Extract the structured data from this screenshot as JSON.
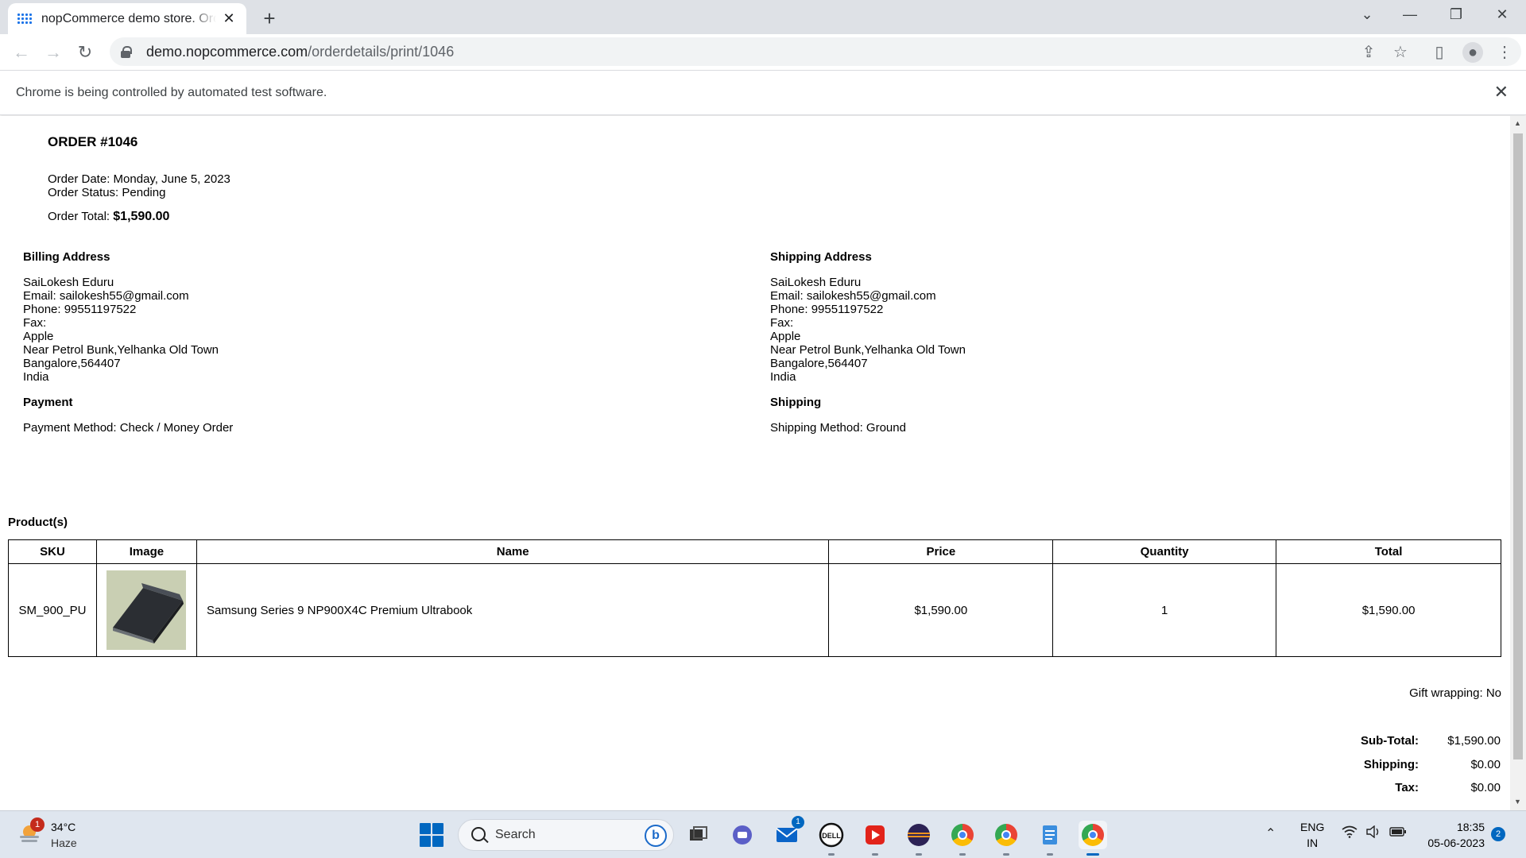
{
  "browser": {
    "tab_title": "nopCommerce demo store. Order details",
    "url_host": "demo.nopcommerce.com",
    "url_path": "/orderdetails/print/1046",
    "infobar_text": "Chrome is being controlled by automated test software."
  },
  "order": {
    "title": "ORDER #1046",
    "date_label": "Order Date:",
    "date_value": "Monday, June 5, 2023",
    "status_label": "Order Status:",
    "status_value": "Pending",
    "total_label": "Order Total:",
    "total_value": "$1,590.00"
  },
  "billing": {
    "title": "Billing Address",
    "lines": [
      "SaiLokesh Eduru",
      "Email: sailokesh55@gmail.com",
      "Phone: 99551197522",
      "Fax:",
      "Apple",
      "Near Petrol Bunk,Yelhanka Old Town",
      "Bangalore,564407",
      "India"
    ]
  },
  "shipping_address": {
    "title": "Shipping Address",
    "lines": [
      "SaiLokesh Eduru",
      "Email: sailokesh55@gmail.com",
      "Phone: 99551197522",
      "Fax:",
      "Apple",
      "Near Petrol Bunk,Yelhanka Old Town",
      "Bangalore,564407",
      "India"
    ]
  },
  "payment": {
    "title": "Payment",
    "method": "Payment Method: Check / Money Order"
  },
  "shipping": {
    "title": "Shipping",
    "method": "Shipping Method: Ground"
  },
  "products": {
    "title": "Product(s)",
    "headers": [
      "SKU",
      "Image",
      "Name",
      "Price",
      "Quantity",
      "Total"
    ],
    "rows": [
      {
        "sku": "SM_900_PU",
        "name": "Samsung Series 9 NP900X4C Premium Ultrabook",
        "price": "$1,590.00",
        "quantity": "1",
        "total": "$1,590.00"
      }
    ]
  },
  "gift_wrapping": "Gift wrapping: No",
  "totals": {
    "subtotal_label": "Sub-Total:",
    "subtotal_value": "$1,590.00",
    "shipping_label": "Shipping:",
    "shipping_value": "$0.00",
    "tax_label": "Tax:",
    "tax_value": "$0.00"
  },
  "taskbar": {
    "weather_badge": "1",
    "temperature": "34°C",
    "condition": "Haze",
    "search_placeholder": "Search",
    "mail_badge": "1",
    "lang_line1": "ENG",
    "lang_line2": "IN",
    "time": "18:35",
    "date": "05-06-2023",
    "notification_count": "2"
  }
}
